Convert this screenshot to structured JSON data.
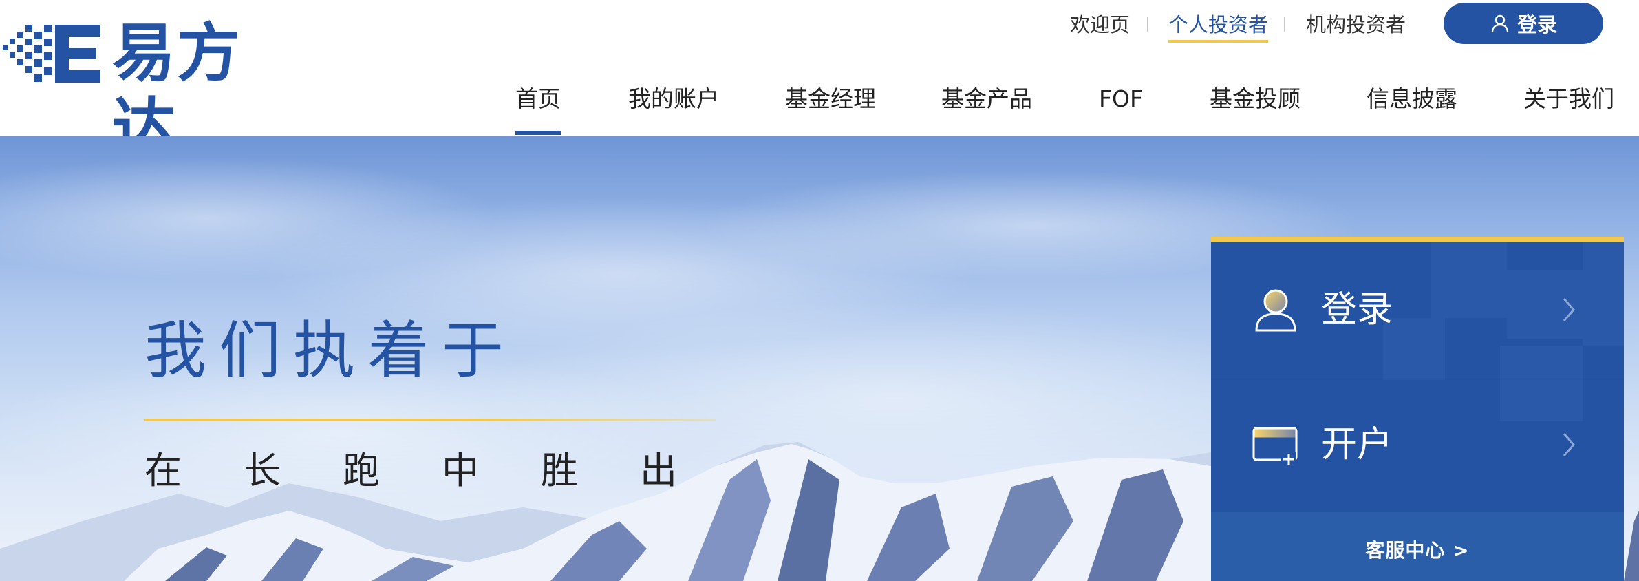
{
  "brand": {
    "name": "易方达",
    "primary_color": "#2553a3",
    "accent_color": "#f2c94c"
  },
  "top_links": [
    {
      "label": "欢迎页",
      "active": false
    },
    {
      "label": "个人投资者",
      "active": true
    },
    {
      "label": "机构投资者",
      "active": false
    }
  ],
  "login_button": {
    "label": "登录",
    "icon": "user-icon"
  },
  "nav": [
    {
      "label": "首页",
      "active": true
    },
    {
      "label": "我的账户"
    },
    {
      "label": "基金经理"
    },
    {
      "label": "基金产品"
    },
    {
      "label": "FOF"
    },
    {
      "label": "基金投顾"
    },
    {
      "label": "信息披露"
    },
    {
      "label": "关于我们"
    }
  ],
  "hero": {
    "headline": "我们执着于",
    "subline_chars": [
      "在",
      "长",
      "跑",
      "中",
      "胜",
      "出"
    ]
  },
  "side_panel": {
    "items": [
      {
        "label": "登录",
        "icon": "user-avatar-icon"
      },
      {
        "label": "开户",
        "icon": "card-add-icon"
      }
    ],
    "footer": "客服中心 >"
  }
}
